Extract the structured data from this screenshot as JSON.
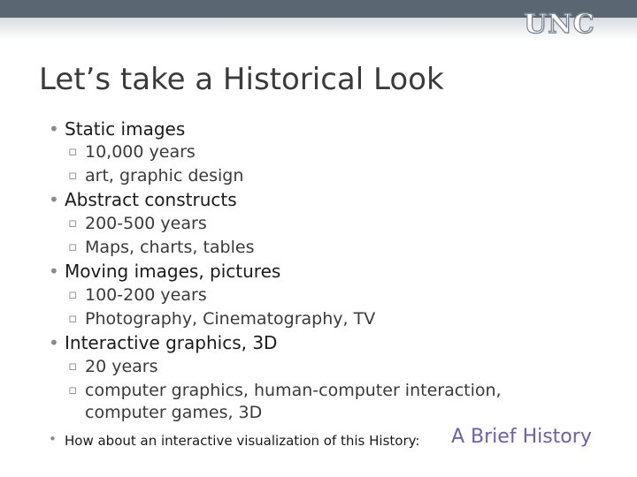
{
  "header": {
    "logo_text": "UNC"
  },
  "slide": {
    "title": "Let’s take a Historical Look",
    "bullets": [
      {
        "label": "Static images",
        "subs": [
          "10,000 years",
          "art, graphic design"
        ]
      },
      {
        "label": "Abstract constructs",
        "subs": [
          "200-500 years",
          "Maps, charts, tables"
        ]
      },
      {
        "label": "Moving images, pictures",
        "subs": [
          "100-200 years",
          "Photography, Cinematography, TV"
        ]
      },
      {
        "label": "Interactive graphics, 3D",
        "subs": [
          "20 years",
          "computer graphics, human-computer interaction,"
        ],
        "continuation": "computer games, 3D"
      }
    ],
    "footnote": {
      "text": "How about an interactive visualization of this History:",
      "link_text": "A Brief History"
    }
  },
  "colors": {
    "top_bar": "#5a6772",
    "link": "#7060a8",
    "title": "#3b3b3b"
  }
}
